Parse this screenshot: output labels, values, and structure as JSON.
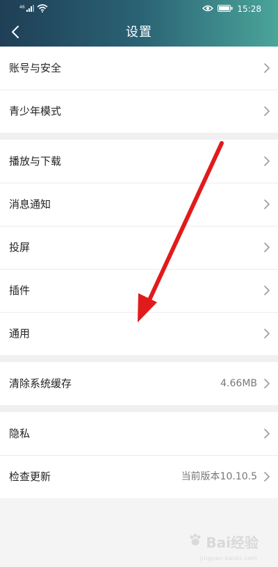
{
  "status_bar": {
    "signal_text": "46",
    "time": "15:28",
    "icons": [
      "signal-icon",
      "wifi-icon",
      "eye-icon",
      "battery-icon"
    ]
  },
  "header": {
    "title": "设置",
    "back_icon": "chevron-left-icon"
  },
  "groups": [
    {
      "rows": [
        {
          "label": "账号与安全",
          "value": ""
        },
        {
          "label": "青少年模式",
          "value": ""
        }
      ]
    },
    {
      "rows": [
        {
          "label": "播放与下载",
          "value": ""
        },
        {
          "label": "消息通知",
          "value": ""
        },
        {
          "label": "投屏",
          "value": ""
        },
        {
          "label": "插件",
          "value": ""
        },
        {
          "label": "通用",
          "value": ""
        }
      ]
    },
    {
      "rows": [
        {
          "label": "清除系统缓存",
          "value": "4.66MB"
        }
      ]
    },
    {
      "rows": [
        {
          "label": "隐私",
          "value": ""
        },
        {
          "label": "检查更新",
          "value": "当前版本10.10.5"
        }
      ]
    }
  ],
  "watermark": {
    "main": "Bai经验",
    "sub": "jingyan.baidu.com"
  },
  "colors": {
    "header_start": "#1f3f56",
    "header_end": "#4aa59a",
    "annotation_arrow": "#e11b1b"
  }
}
